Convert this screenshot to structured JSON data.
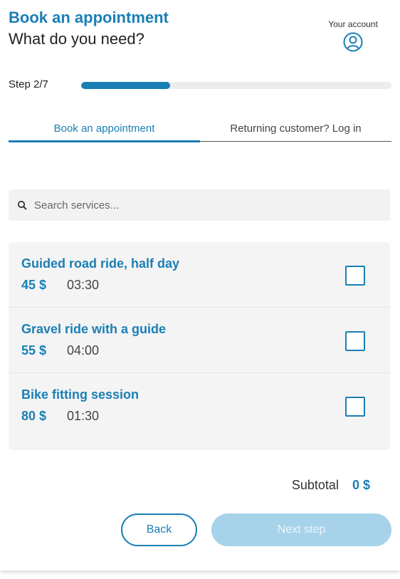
{
  "header": {
    "title": "Book an appointment",
    "subtitle": "What do you need?",
    "account_label": "Your account",
    "account_icon": "user-circle-icon"
  },
  "progress": {
    "label": "Step 2/7",
    "current": 2,
    "total": 7
  },
  "tabs": [
    {
      "label": "Book an appointment",
      "active": true
    },
    {
      "label": "Returning customer? Log in",
      "active": false
    }
  ],
  "search": {
    "icon": "search-icon",
    "placeholder": "Search services...",
    "value": ""
  },
  "services": [
    {
      "name": "Guided road ride, half day",
      "price": "45 $",
      "duration": "03:30",
      "checked": false
    },
    {
      "name": "Gravel ride with a guide",
      "price": "55 $",
      "duration": "04:00",
      "checked": false
    },
    {
      "name": "Bike fitting session",
      "price": "80 $",
      "duration": "01:30",
      "checked": false
    }
  ],
  "subtotal": {
    "label": "Subtotal",
    "value": "0 $"
  },
  "buttons": {
    "back": "Back",
    "next": "Next step"
  },
  "colors": {
    "accent": "#1a7fb5",
    "accent_disabled": "#a6d3ea",
    "panel_bg": "#f4f4f4"
  }
}
